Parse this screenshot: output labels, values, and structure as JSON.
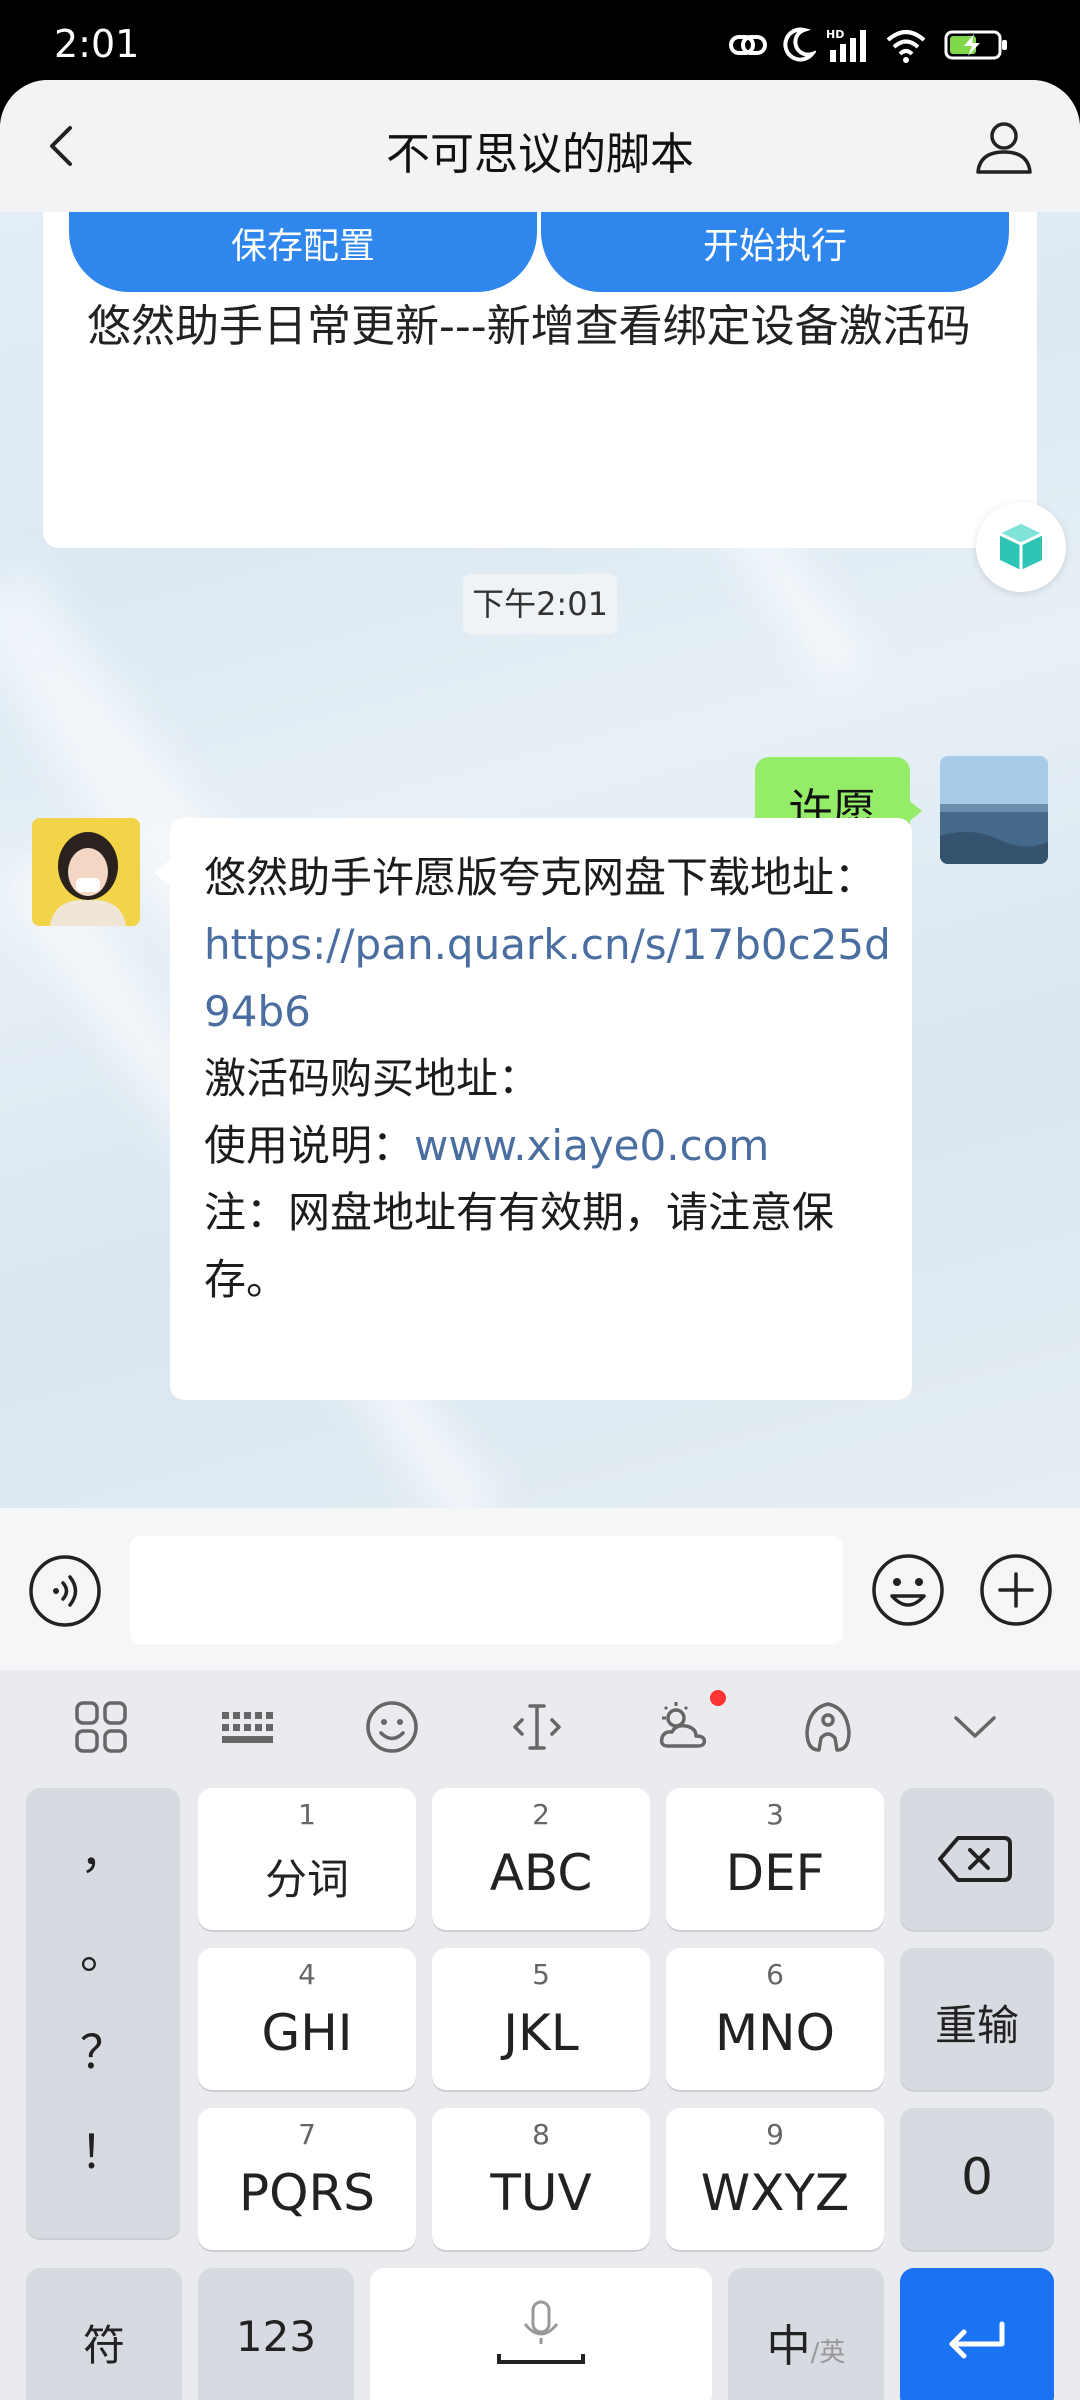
{
  "status_bar": {
    "time": "2:01",
    "icons": [
      "link-icon",
      "moon-icon",
      "hd-signal-icon",
      "wifi-icon",
      "battery-charging-icon"
    ]
  },
  "header": {
    "title": "不可思议的脚本",
    "back_icon": "chevron-left-icon",
    "profile_icon": "person-icon"
  },
  "chat": {
    "script_card": {
      "buttons": [
        "保存配置",
        "开始执行"
      ],
      "text": "悠然助手日常更新---新增查看绑定设备激活码"
    },
    "timestamp": "下午2:01",
    "outgoing_message": "许愿",
    "incoming_message": {
      "line1": "悠然助手许愿版夸克网盘下载地址：",
      "link1": "https://pan.quark.cn/s/17b0c25d94b6",
      "line2": "激活码购买地址：",
      "line3_prefix": "使用说明：",
      "link2": "www.xiaye0.com",
      "line4": "注：网盘地址有有效期，请注意保存。"
    }
  },
  "input_bar": {
    "placeholder": "",
    "icons": [
      "voice-icon",
      "emoji-icon",
      "plus-icon"
    ]
  },
  "keyboard": {
    "toolbar": [
      "grid-icon",
      "keyboard-icon",
      "emoji-icon",
      "cursor-icon",
      "weather-icon",
      "skin-icon",
      "chevron-down-icon"
    ],
    "left_punct": [
      "，",
      "。",
      "？",
      "！"
    ],
    "keys": [
      {
        "num": "1",
        "label": "分词"
      },
      {
        "num": "2",
        "label": "ABC"
      },
      {
        "num": "3",
        "label": "DEF"
      },
      {
        "num": "4",
        "label": "GHI"
      },
      {
        "num": "5",
        "label": "JKL"
      },
      {
        "num": "6",
        "label": "MNO"
      },
      {
        "num": "7",
        "label": "PQRS"
      },
      {
        "num": "8",
        "label": "TUV"
      },
      {
        "num": "9",
        "label": "WXYZ"
      }
    ],
    "reenter": "重输",
    "zero": "0",
    "symbol": "符",
    "numbers": "123",
    "lang_main": "中",
    "lang_sub": "/英"
  },
  "colors": {
    "accent_blue": "#2f86ec",
    "wish_bubble": "#95ec69",
    "enter_key": "#1a73f2",
    "link": "#4a6ea0"
  }
}
